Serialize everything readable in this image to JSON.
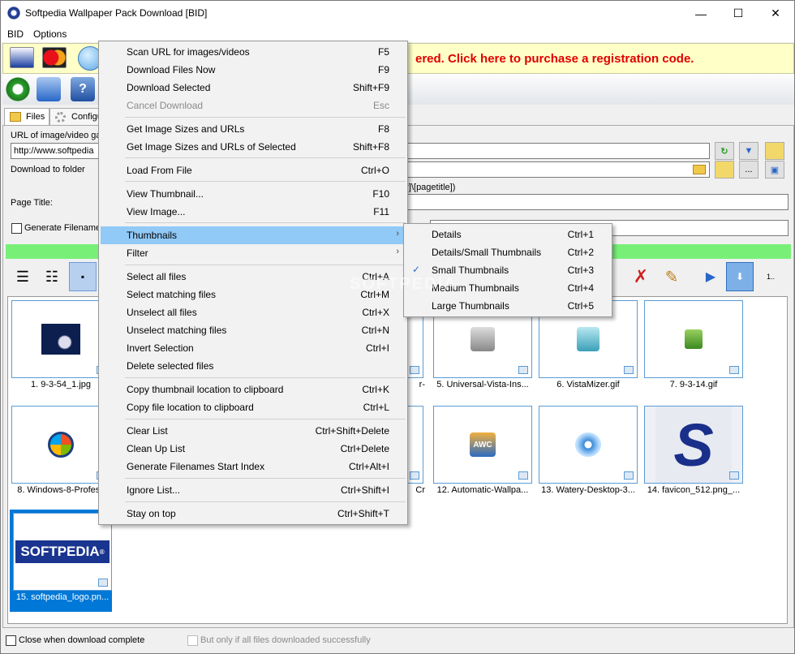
{
  "window": {
    "title": "Softpedia Wallpaper Pack Download [BID]",
    "controls": {
      "minimize": "—",
      "maximize": "☐",
      "close": "✕"
    }
  },
  "menubar": {
    "items": [
      "BID",
      "Options"
    ]
  },
  "banner": {
    "message": "ered. Click here to purchase a registration code."
  },
  "tabs": [
    {
      "label": "Files"
    },
    {
      "label": "Configu"
    }
  ],
  "form": {
    "url_label": "URL of image/video ga",
    "url_value": "http://www.softpedia",
    "folder_label": "Download to folder",
    "path_suffix": "der]\\[pagetitle])",
    "page_title_label": "Page Title:",
    "generate_filenames_label": "Generate Filenames"
  },
  "watermark": "SOFTPEDIA",
  "thumbnails": [
    {
      "caption": "1. 9-3-54_1.jpg",
      "icon": "moon-night-image"
    },
    {
      "caption": "r-",
      "icon": ""
    },
    {
      "caption": "5. Universal-Vista-Ins...",
      "icon": "installer-icon"
    },
    {
      "caption": "6. VistaMizer.gif",
      "icon": "vistamizer-icon"
    },
    {
      "caption": "7. 9-3-14.gif",
      "icon": "green-puzzle-icon"
    },
    {
      "caption": "8. Windows-8-Profess",
      "icon": "windows-logo-icon"
    },
    {
      "caption": "Cr",
      "icon": ""
    },
    {
      "caption": "12. Automatic-Wallpa...",
      "icon": "awc-icon"
    },
    {
      "caption": "13. Watery-Desktop-3...",
      "icon": "watery-icon"
    },
    {
      "caption": "14. favicon_512.png_...",
      "icon": "softpedia-s-icon"
    },
    {
      "caption": "15. softpedia_logo.pn...",
      "icon": "softpedia-logo-image",
      "logo_text": "SOFTPEDIA",
      "logo_mark": "®"
    }
  ],
  "status": {
    "close_when_done": "Close when download complete",
    "only_if_success": "But only if all files downloaded successfully"
  },
  "context_menu": [
    {
      "label": "Scan URL for images/videos",
      "shortcut": "F5"
    },
    {
      "label": "Download Files Now",
      "shortcut": "F9"
    },
    {
      "label": "Download Selected",
      "shortcut": "Shift+F9"
    },
    {
      "label": "Cancel Download",
      "shortcut": "Esc",
      "disabled": true
    },
    {
      "label": "Get Image Sizes and URLs",
      "shortcut": "F8"
    },
    {
      "label": "Get Image Sizes and URLs of Selected",
      "shortcut": "Shift+F8"
    },
    {
      "label": "Load From File",
      "shortcut": "Ctrl+O"
    },
    {
      "label": "View Thumbnail...",
      "shortcut": "F10"
    },
    {
      "label": "View Image...",
      "shortcut": "F11"
    },
    {
      "label": "Thumbnails",
      "shortcut": "",
      "submenu": true,
      "highlighted": true
    },
    {
      "label": "Filter",
      "shortcut": "",
      "submenu": true
    },
    {
      "label": "Select all files",
      "shortcut": "Ctrl+A"
    },
    {
      "label": "Select matching files",
      "shortcut": "Ctrl+M"
    },
    {
      "label": "Unselect all files",
      "shortcut": "Ctrl+X"
    },
    {
      "label": "Unselect matching files",
      "shortcut": "Ctrl+N"
    },
    {
      "label": "Invert Selection",
      "shortcut": "Ctrl+I"
    },
    {
      "label": "Delete selected files",
      "shortcut": ""
    },
    {
      "label": "Copy thumbnail location to clipboard",
      "shortcut": "Ctrl+K"
    },
    {
      "label": "Copy file location to clipboard",
      "shortcut": "Ctrl+L"
    },
    {
      "label": "Clear List",
      "shortcut": "Ctrl+Shift+Delete"
    },
    {
      "label": "Clean Up List",
      "shortcut": "Ctrl+Delete"
    },
    {
      "label": "Generate Filenames Start Index",
      "shortcut": "Ctrl+Alt+I"
    },
    {
      "label": "Ignore List...",
      "shortcut": "Ctrl+Shift+I"
    },
    {
      "label": "Stay on top",
      "shortcut": "Ctrl+Shift+T"
    }
  ],
  "thumbnails_submenu": [
    {
      "label": "Details",
      "shortcut": "Ctrl+1"
    },
    {
      "label": "Details/Small Thumbnails",
      "shortcut": "Ctrl+2"
    },
    {
      "label": "Small Thumbnails",
      "shortcut": "Ctrl+3",
      "checked": true
    },
    {
      "label": "Medium Thumbnails",
      "shortcut": "Ctrl+4"
    },
    {
      "label": "Large Thumbnails",
      "shortcut": "Ctrl+5"
    }
  ],
  "colors": {
    "banner_text": "#e00000",
    "banner_bg": "#ffffc8",
    "menu_highlight": "#91c9f7",
    "progress_green": "#78f078",
    "selection_blue": "#0078d7"
  }
}
